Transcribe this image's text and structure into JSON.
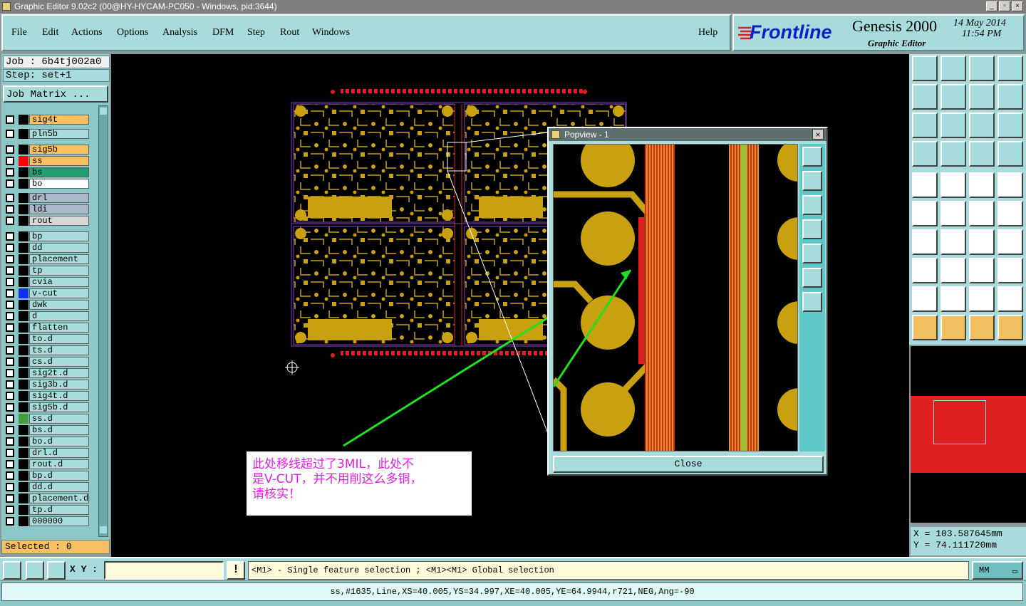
{
  "window": {
    "title": "Graphic Editor 9.02c2 (00@HY-HYCAM-PC050 - Windows, pid:3644)"
  },
  "menu": [
    "File",
    "Edit",
    "Actions",
    "Options",
    "Analysis",
    "DFM",
    "Step",
    "Rout",
    "Windows"
  ],
  "help_label": "Help",
  "brand": {
    "logo": "Frontline",
    "product": "Genesis 2000",
    "module": "Graphic Editor",
    "date": "14 May 2014",
    "time": "11:54 PM"
  },
  "job": {
    "job_label": "Job : 6b4tj002a0",
    "step_label": "Step: set+1",
    "matrix_button": "Job Matrix ..."
  },
  "layers": [
    {
      "name": "sig4t",
      "color": "#f8c060",
      "swatch": "#000"
    },
    {
      "name": "pln5b",
      "color": "#a8dcdc",
      "swatch": "#000"
    },
    {
      "name": "sig5b",
      "color": "#f8c060",
      "swatch": "#000"
    },
    {
      "name": "ss",
      "color": "#f8c060",
      "swatch": "#ff0000"
    },
    {
      "name": "bs",
      "color": "#20a070",
      "swatch": "#000"
    },
    {
      "name": "bo",
      "color": "#ffffff",
      "swatch": "#000"
    },
    {
      "name": "drl",
      "color": "#a8b8c8",
      "swatch": "#000"
    },
    {
      "name": "ldi",
      "color": "#a8b8c8",
      "swatch": "#000"
    },
    {
      "name": "rout",
      "color": "#d8d8d8",
      "swatch": "#000"
    },
    {
      "name": "bp",
      "color": "#a8dcdc",
      "swatch": "#000"
    },
    {
      "name": "dd",
      "color": "#a8dcdc",
      "swatch": "#000"
    },
    {
      "name": "placement",
      "color": "#a8dcdc",
      "swatch": "#000"
    },
    {
      "name": "tp",
      "color": "#a8dcdc",
      "swatch": "#000"
    },
    {
      "name": "cvia",
      "color": "#a8dcdc",
      "swatch": "#000"
    },
    {
      "name": "v-cut",
      "color": "#a8dcdc",
      "swatch": "#1030f0"
    },
    {
      "name": "dwk",
      "color": "#a8dcdc",
      "swatch": "#000"
    },
    {
      "name": "d",
      "color": "#a8dcdc",
      "swatch": "#000"
    },
    {
      "name": "flatten",
      "color": "#a8dcdc",
      "swatch": "#000"
    },
    {
      "name": "to.d",
      "color": "#a8dcdc",
      "swatch": "#000"
    },
    {
      "name": "ts.d",
      "color": "#a8dcdc",
      "swatch": "#000"
    },
    {
      "name": "cs.d",
      "color": "#a8dcdc",
      "swatch": "#000"
    },
    {
      "name": "sig2t.d",
      "color": "#a8dcdc",
      "swatch": "#000"
    },
    {
      "name": "sig3b.d",
      "color": "#a8dcdc",
      "swatch": "#000"
    },
    {
      "name": "sig4t.d",
      "color": "#a8dcdc",
      "swatch": "#000"
    },
    {
      "name": "sig5b.d",
      "color": "#a8dcdc",
      "swatch": "#000"
    },
    {
      "name": "ss.d",
      "color": "#a8dcdc",
      "swatch": "#40a040"
    },
    {
      "name": "bs.d",
      "color": "#a8dcdc",
      "swatch": "#000"
    },
    {
      "name": "bo.d",
      "color": "#a8dcdc",
      "swatch": "#000"
    },
    {
      "name": "drl.d",
      "color": "#a8dcdc",
      "swatch": "#000"
    },
    {
      "name": "rout.d",
      "color": "#a8dcdc",
      "swatch": "#000"
    },
    {
      "name": "bp.d",
      "color": "#a8dcdc",
      "swatch": "#000"
    },
    {
      "name": "dd.d",
      "color": "#a8dcdc",
      "swatch": "#000"
    },
    {
      "name": "placement.d",
      "color": "#a8dcdc",
      "swatch": "#000"
    },
    {
      "name": "tp.d",
      "color": "#a8dcdc",
      "swatch": "#000"
    },
    {
      "name": "000000",
      "color": "#a8dcdc",
      "swatch": "#000"
    }
  ],
  "selected_label": "Selected : 0",
  "popview": {
    "title": "Popview - 1",
    "close_label": "Close"
  },
  "note": {
    "line1": "此处移线超过了3MIL，此处不",
    "line2": "是V-CUT，并不用削这么多铜，",
    "line3": "请核实！"
  },
  "coords": {
    "x": "X = 103.587645mm",
    "y": "Y = 74.111720mm"
  },
  "xy_label": "X Y :",
  "xy_placeholder": "",
  "status_hint": "<M1> - Single feature selection ; <M1><M1> Global selection",
  "units": "MM",
  "feature_info": "ss,#1635,Line,XS=40.005,YS=34.997,XE=40.005,YE=64.9944,r721,NEG,Ang=-90",
  "colors": {
    "copper": "#c8a010",
    "panel": "#a8dcdc",
    "highlight": "#f8c060",
    "arrow": "#20e020"
  }
}
